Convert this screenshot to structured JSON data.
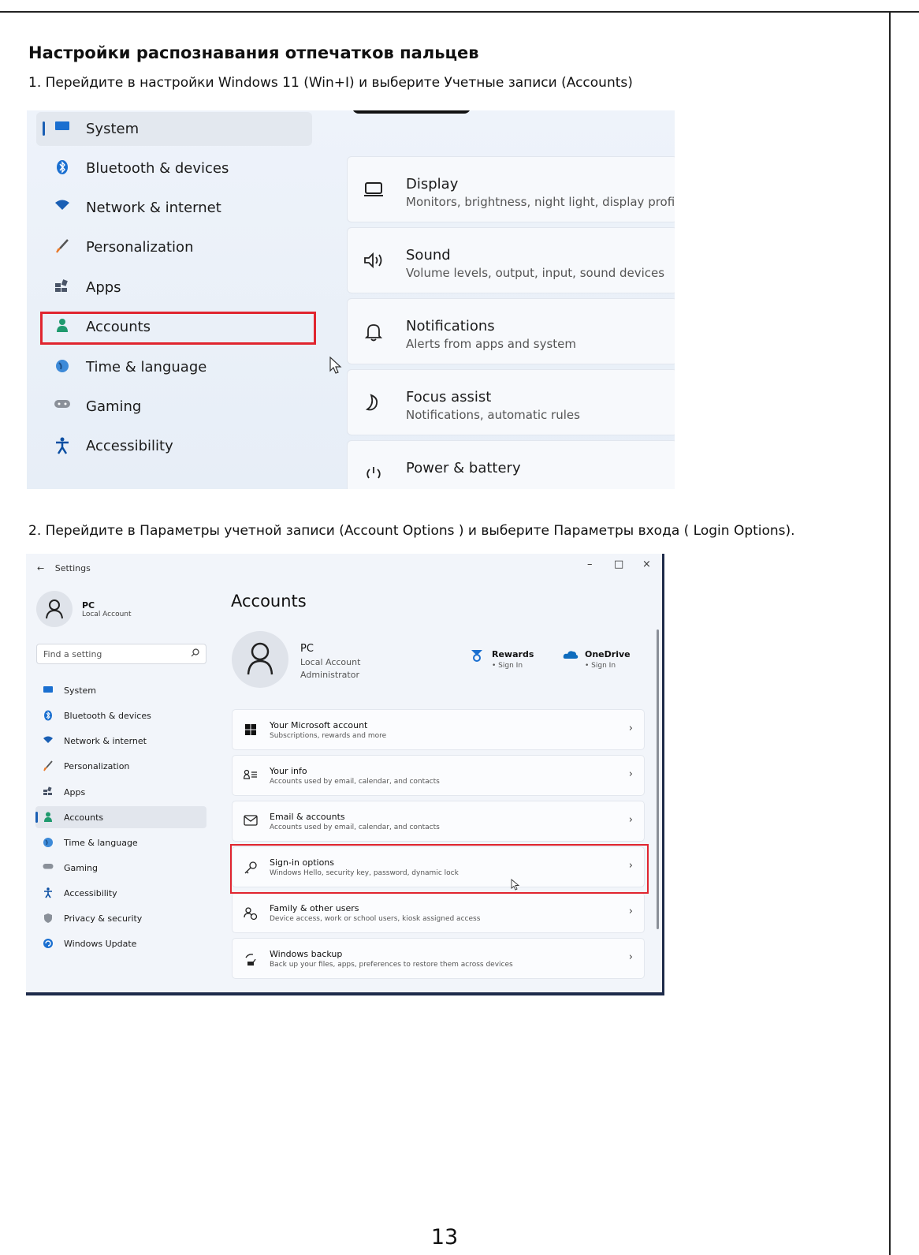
{
  "document": {
    "heading": "Настройки распознавания отпечатков пальцев",
    "step1": "1. Перейдите в настройки Windows 11 (Win+I) и выберите  Учетные записи  (Accounts)",
    "step2": "2. Перейдите в  Параметры учетной записи (Account Options ) и выберите Параметры входа ( Login Options).",
    "page_number": "13"
  },
  "screenshot1": {
    "nav_items": [
      {
        "label": "System",
        "icon": "monitor-icon"
      },
      {
        "label": "Bluetooth & devices",
        "icon": "bluetooth-icon"
      },
      {
        "label": "Network & internet",
        "icon": "wifi-icon"
      },
      {
        "label": "Personalization",
        "icon": "brush-icon"
      },
      {
        "label": "Apps",
        "icon": "apps-icon"
      },
      {
        "label": "Accounts",
        "icon": "person-icon"
      },
      {
        "label": "Time & language",
        "icon": "globe-clock-icon"
      },
      {
        "label": "Gaming",
        "icon": "gamepad-icon"
      },
      {
        "label": "Accessibility",
        "icon": "accessibility-icon"
      }
    ],
    "cards": [
      {
        "title": "Display",
        "desc": "Monitors, brightness, night light, display profile",
        "icon": "display-icon"
      },
      {
        "title": "Sound",
        "desc": "Volume levels, output, input, sound devices",
        "icon": "speaker-icon"
      },
      {
        "title": "Notifications",
        "desc": "Alerts from apps and system",
        "icon": "bell-icon"
      },
      {
        "title": "Focus assist",
        "desc": "Notifications, automatic rules",
        "icon": "moon-icon"
      },
      {
        "title": "Power & battery",
        "desc": "",
        "icon": "power-icon"
      }
    ],
    "highlight_color": "#e0252f"
  },
  "screenshot2": {
    "window_title": "Settings",
    "back_glyph": "←",
    "controls": {
      "minimize": "–",
      "maximize": "□",
      "close": "×"
    },
    "user": {
      "name": "PC",
      "type": "Local Account"
    },
    "search_placeholder": "Find a setting",
    "nav_items": [
      {
        "label": "System",
        "icon": "monitor-icon"
      },
      {
        "label": "Bluetooth & devices",
        "icon": "bluetooth-icon"
      },
      {
        "label": "Network & internet",
        "icon": "wifi-icon"
      },
      {
        "label": "Personalization",
        "icon": "brush-icon"
      },
      {
        "label": "Apps",
        "icon": "apps-icon"
      },
      {
        "label": "Accounts",
        "icon": "person-icon"
      },
      {
        "label": "Time & language",
        "icon": "globe-clock-icon"
      },
      {
        "label": "Gaming",
        "icon": "gamepad-icon"
      },
      {
        "label": "Accessibility",
        "icon": "accessibility-icon"
      },
      {
        "label": "Privacy & security",
        "icon": "shield-icon"
      },
      {
        "label": "Windows Update",
        "icon": "update-icon"
      }
    ],
    "page_title": "Accounts",
    "profile": {
      "name": "PC",
      "line1": "Local Account",
      "line2": "Administrator"
    },
    "services": [
      {
        "name": "Rewards",
        "status": "• Sign In",
        "icon": "rewards-icon"
      },
      {
        "name": "OneDrive",
        "status": "• Sign In",
        "icon": "onedrive-icon"
      }
    ],
    "rows": [
      {
        "title": "Your Microsoft account",
        "desc": "Subscriptions, rewards and more",
        "icon": "windows-logo-icon"
      },
      {
        "title": "Your info",
        "desc": "Accounts used by email, calendar, and contacts",
        "icon": "person-info-icon"
      },
      {
        "title": "Email & accounts",
        "desc": "Accounts used by email, calendar, and contacts",
        "icon": "mail-icon"
      },
      {
        "title": "Sign-in options",
        "desc": "Windows Hello, security key, password, dynamic lock",
        "icon": "key-icon"
      },
      {
        "title": "Family & other users",
        "desc": "Device access, work or school users, kiosk assigned access",
        "icon": "family-icon"
      },
      {
        "title": "Windows backup",
        "desc": "Back up your files, apps, preferences to restore them across devices",
        "icon": "backup-icon"
      }
    ],
    "chevron": "›",
    "highlight_color": "#e0252f"
  }
}
